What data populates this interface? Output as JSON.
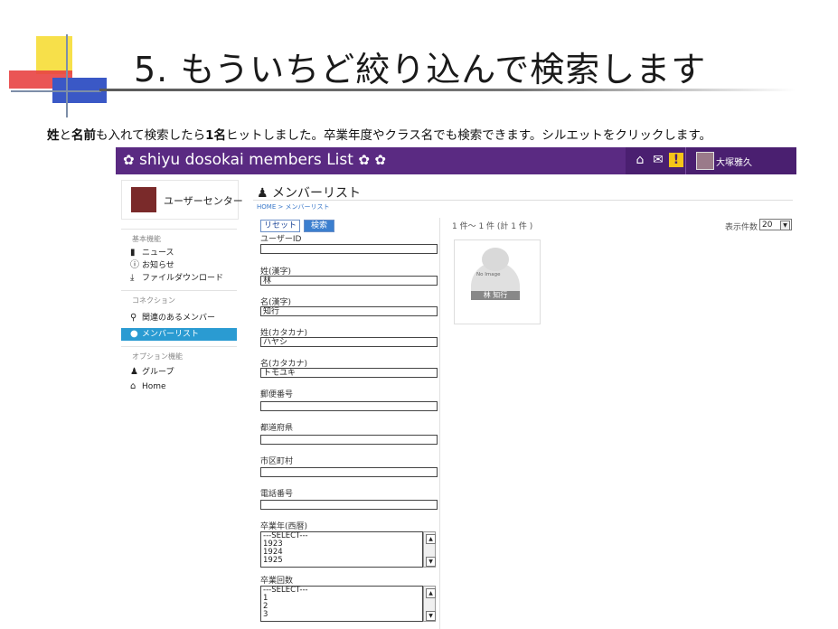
{
  "slide": {
    "title": "5. もういちど絞り込んで検索します",
    "caption_bold1": "姓",
    "caption_mid1": "と",
    "caption_bold2": "名前",
    "caption_mid2": "も入れて検索したら",
    "caption_bold3": "1名",
    "caption_rest": "ヒットしました。卒業年度やクラス名でも検索できます。シルエットをクリックします。"
  },
  "topbar": {
    "brand": "shiyu dosokai members List",
    "flower_icon": "✿",
    "user_name": "大塚雅久",
    "color": "#5a2a82"
  },
  "sidebar": {
    "user_center": "ユーザーセンター",
    "sections": [
      {
        "heading": "基本機能",
        "items": [
          {
            "label": "ニュース",
            "icon": "doc-icon"
          },
          {
            "label": "お知らせ",
            "icon": "info-icon"
          },
          {
            "label": "ファイルダウンロード",
            "icon": "download-icon"
          }
        ]
      },
      {
        "heading": "コネクション",
        "items": [
          {
            "label": "関連のあるメンバー",
            "icon": "search-icon"
          },
          {
            "label": "メンバーリスト",
            "icon": "person-icon",
            "active": true
          }
        ]
      },
      {
        "heading": "オプション機能",
        "items": [
          {
            "label": "グループ",
            "icon": "group-icon"
          },
          {
            "label": "Home",
            "icon": "home-icon"
          }
        ]
      }
    ],
    "active_color": "#2a9bd2"
  },
  "content": {
    "page_title": "メンバーリスト",
    "breadcrumb": "HOME > メンバーリスト",
    "reset_label": "リセット",
    "search_label": "検索",
    "fields": [
      {
        "label": "ユーザーID",
        "value": ""
      },
      {
        "label": "姓(漢字)",
        "value": "林"
      },
      {
        "label": "名(漢字)",
        "value": "知行"
      },
      {
        "label": "姓(カタカナ)",
        "value": "ハヤシ"
      },
      {
        "label": "名(カタカナ)",
        "value": "トモユキ"
      },
      {
        "label": "郵便番号",
        "value": ""
      },
      {
        "label": "都道府県",
        "value": ""
      },
      {
        "label": "市区町村",
        "value": ""
      },
      {
        "label": "電話番号",
        "value": ""
      }
    ],
    "grad_year": {
      "label": "卒業年(西暦)",
      "options": [
        "---SELECT---",
        "1923",
        "1924",
        "1925"
      ]
    },
    "grad_count": {
      "label": "卒業回数",
      "options": [
        "---SELECT---",
        "1",
        "2",
        "3"
      ]
    },
    "result_count": "1 件～ 1 件 (計 1 件 )",
    "per_page_label": "表示件数",
    "per_page_value": "20",
    "result": {
      "no_image": "No Image",
      "name": "林 知行"
    }
  }
}
